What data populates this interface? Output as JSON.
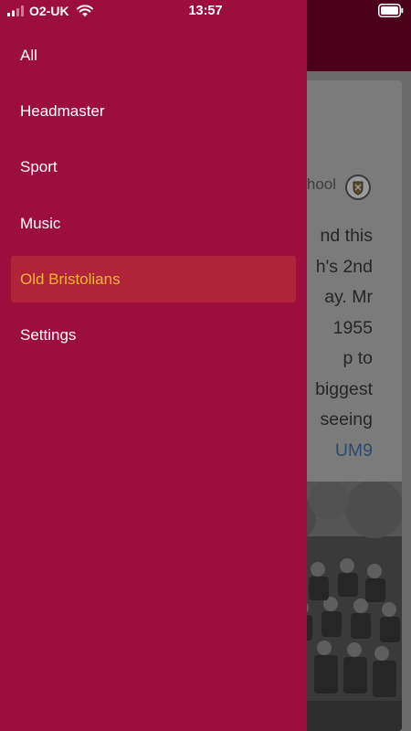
{
  "status_bar": {
    "carrier": "O2-UK",
    "time": "13:57"
  },
  "drawer": {
    "items": [
      {
        "label": "All"
      },
      {
        "label": "Headmaster"
      },
      {
        "label": "Sport"
      },
      {
        "label": "Music"
      },
      {
        "label": "Old Bristolians"
      },
      {
        "label": "Settings"
      }
    ],
    "active_index": 4
  },
  "background": {
    "source_fragment": "hool",
    "body_lines": [
      "nd this",
      "h's 2nd",
      "ay. Mr",
      "1955",
      "p to",
      "biggest",
      "seeing"
    ],
    "link_fragment": "UM9"
  },
  "colors": {
    "drawer_bg": "#9c0e3d",
    "active_bg": "#b12338",
    "active_text": "#f5b632",
    "header_bg": "#4a0119"
  }
}
